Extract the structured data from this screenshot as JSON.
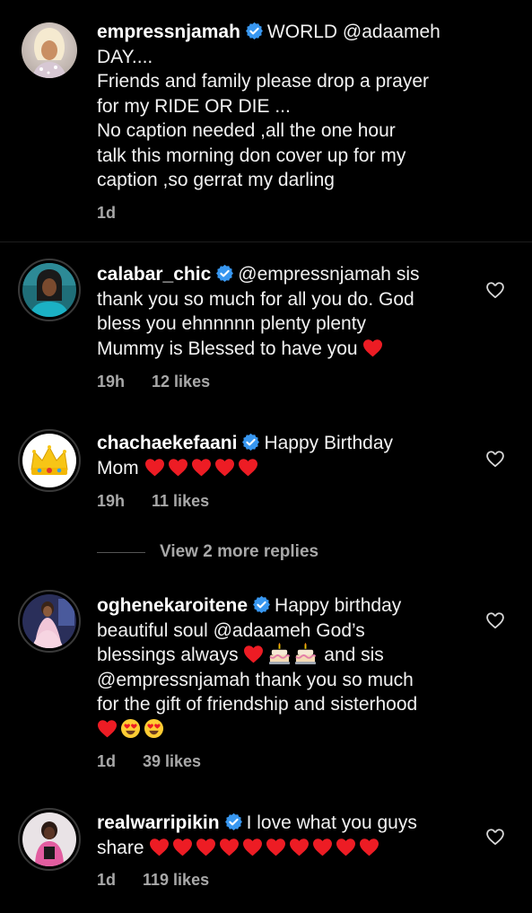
{
  "colors": {
    "background": "#000000",
    "text": "#f2f2f2",
    "meta": "#a8a8a8",
    "verified": "#3897f0",
    "heart": "#ed1c24"
  },
  "comments": [
    {
      "username": "empressnjamah",
      "verified": true,
      "text_lines": [
        "WORLD @adaameh",
        "DAY....",
        "Friends and family please drop a prayer",
        "for my RIDE OR DIE ...",
        "No caption needed ,all the one hour",
        "talk this morning don cover up for my",
        "caption ,so gerrat my darling"
      ],
      "time": "1d",
      "likes": ""
    },
    {
      "username": "calabar_chic",
      "verified": true,
      "text_lines": [
        "@empressnjamah sis",
        "thank you so much for all you do. God",
        "bless you ehnnnnn plenty plenty",
        "Mummy is Blessed to have you"
      ],
      "time": "19h",
      "likes": "12 likes",
      "like_icon": "heart-outline-icon"
    },
    {
      "username": "chachaekefaani",
      "verified": true,
      "text_lines": [
        "Happy Birthday",
        "Mom"
      ],
      "time": "19h",
      "likes": "11 likes",
      "like_icon": "heart-outline-icon"
    },
    {
      "username": "oghenekaroitene",
      "verified": true,
      "text_lines": [
        "Happy birthday",
        "beautiful soul @adaameh God’s",
        "blessings always",
        "and sis",
        "@empressnjamah thank you so much",
        "for the gift of friendship and sisterhood"
      ],
      "time": "1d",
      "likes": "39 likes",
      "like_icon": "heart-outline-icon"
    },
    {
      "username": "realwarripikin",
      "verified": true,
      "text_lines": [
        "I love what you guys",
        "share"
      ],
      "time": "1d",
      "likes": "119 likes",
      "like_icon": "heart-outline-icon"
    }
  ],
  "view_more_replies": "View 2 more replies"
}
